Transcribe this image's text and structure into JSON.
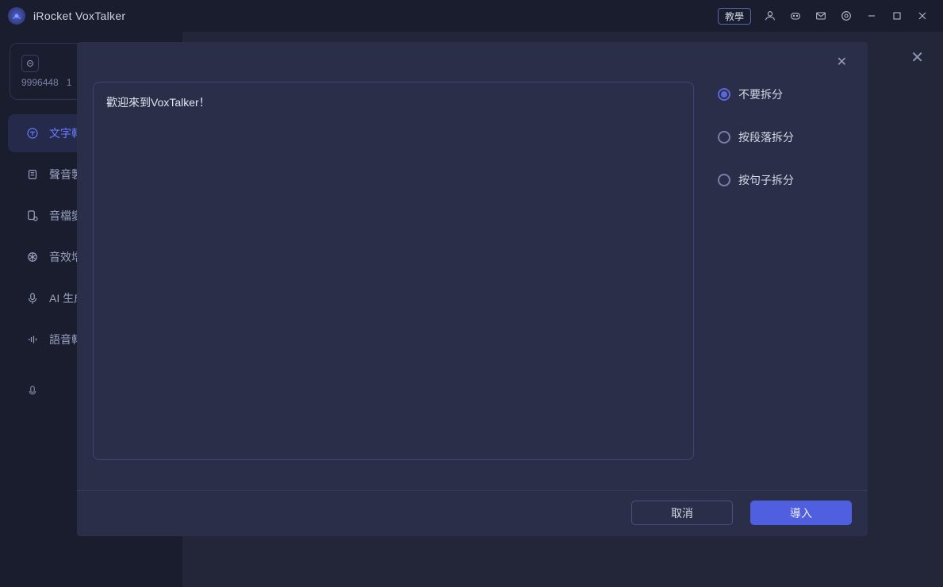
{
  "titlebar": {
    "app_name": "iRocket VoxTalker",
    "tutorial_label": "教學"
  },
  "credit": {
    "value": "9996448",
    "extra": "1"
  },
  "sidebar": {
    "items": [
      {
        "label": "文字轉"
      },
      {
        "label": "聲音製"
      },
      {
        "label": "音檔變"
      },
      {
        "label": "音效增"
      },
      {
        "label": "AI 生成"
      },
      {
        "label": "語音轉"
      }
    ]
  },
  "modal": {
    "text_content": "歡迎來到VoxTalker！",
    "options": [
      {
        "label": "不要拆分",
        "checked": true
      },
      {
        "label": "按段落拆分",
        "checked": false
      },
      {
        "label": "按句子拆分",
        "checked": false
      }
    ],
    "cancel_label": "取消",
    "import_label": "導入"
  }
}
